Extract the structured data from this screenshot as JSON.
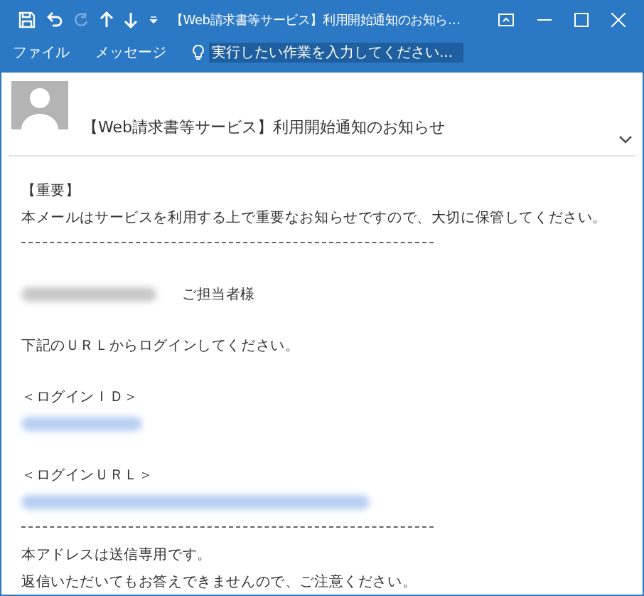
{
  "window": {
    "title": "【Web請求書等サービス】利用開始通知のお知ら…"
  },
  "quick_access": [
    {
      "kind": "save",
      "disabled": false
    },
    {
      "kind": "undo",
      "disabled": false
    },
    {
      "kind": "redo",
      "disabled": true
    },
    {
      "kind": "up",
      "disabled": false
    },
    {
      "kind": "down",
      "disabled": false
    },
    {
      "kind": "more",
      "disabled": false
    }
  ],
  "ribbon": {
    "tabs": [
      {
        "label": "ファイル"
      },
      {
        "label": "メッセージ"
      }
    ],
    "search": {
      "placeholder": "実行したい作業を入力してください..."
    }
  },
  "message": {
    "subject": "【Web請求書等サービス】利用開始通知のお知らせ",
    "body": [
      {
        "kind": "text",
        "text": "【重要】"
      },
      {
        "kind": "text",
        "text": "本メールはサービスを利用する上で重要なお知らせですので、大切に保管してください。"
      },
      {
        "kind": "rule"
      },
      {
        "kind": "blank"
      },
      {
        "kind": "addressee",
        "text": "ご担当者様"
      },
      {
        "kind": "blank"
      },
      {
        "kind": "text",
        "text": "下記のＵＲＬからログインしてください。"
      },
      {
        "kind": "blank"
      },
      {
        "kind": "text",
        "text": "＜ログインＩＤ＞"
      },
      {
        "kind": "redacted_id"
      },
      {
        "kind": "blank"
      },
      {
        "kind": "text",
        "text": "＜ログインＵＲＬ＞"
      },
      {
        "kind": "redacted_url"
      },
      {
        "kind": "rule"
      },
      {
        "kind": "text",
        "text": "本アドレスは送信専用です。"
      },
      {
        "kind": "text",
        "text": "返信いただいてもお答えできませんので、ご注意ください。"
      }
    ]
  }
}
